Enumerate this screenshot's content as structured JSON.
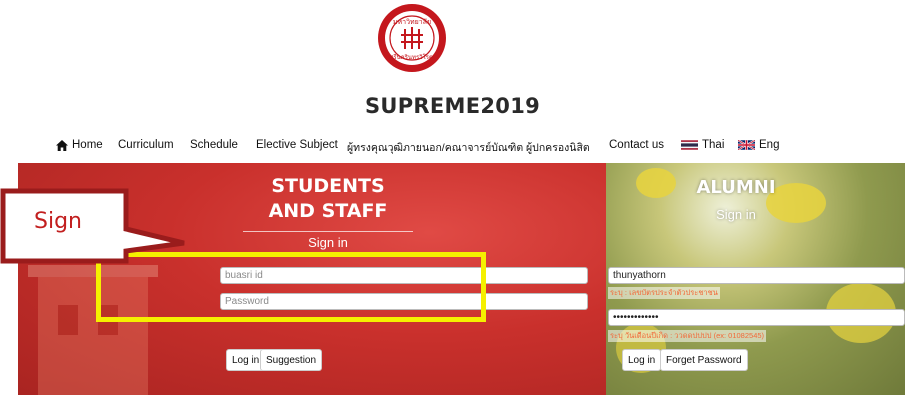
{
  "site": {
    "title": "SUPREME2019"
  },
  "logo": {
    "icon": "university-seal-icon",
    "text_top": "มหาวิทยาลัย",
    "text_bottom": "ศรีนครินทรวิโรฒ",
    "color": "#c4171d"
  },
  "nav": {
    "items": [
      {
        "label": "Home",
        "icon": "home-icon"
      },
      {
        "label": "Curriculum"
      },
      {
        "label": "Schedule"
      },
      {
        "label": "Elective Subject"
      },
      {
        "label": "ผู้ทรงคุณวุฒิภายนอก/คณาจารย์บัณฑิต"
      },
      {
        "label": "ผู้ปกครองนิสิต"
      },
      {
        "label": "Contact us"
      },
      {
        "label": "Thai",
        "icon": "thai-flag-icon"
      },
      {
        "label": "Eng",
        "icon": "uk-flag-icon"
      }
    ]
  },
  "students_panel": {
    "title_line1": "STUDENTS",
    "title_line2": "AND STAFF",
    "subtitle": "Sign in",
    "username_placeholder": "buasri id",
    "password_placeholder": "Password",
    "login_label": "Log in",
    "suggestion_label": "Suggestion",
    "accent_color": "#c9302c"
  },
  "alumni_panel": {
    "title": "ALUMNI",
    "subtitle": "Sign in",
    "username_value": "thunyathorn",
    "username_hint": "ระบุ : เลขบัตรประจำตัวประชาชน",
    "password_value": "•••••••••••••",
    "password_hint": "ระบุ วันเดือนปีเกิด : วว​ดดปปปป (ex: 01082545)",
    "login_label": "Log in",
    "forget_label": "Forget Password"
  },
  "annotation": {
    "callout_text": "Sign",
    "highlight_color": "#f5f000",
    "callout_color": "#c21f1f"
  }
}
